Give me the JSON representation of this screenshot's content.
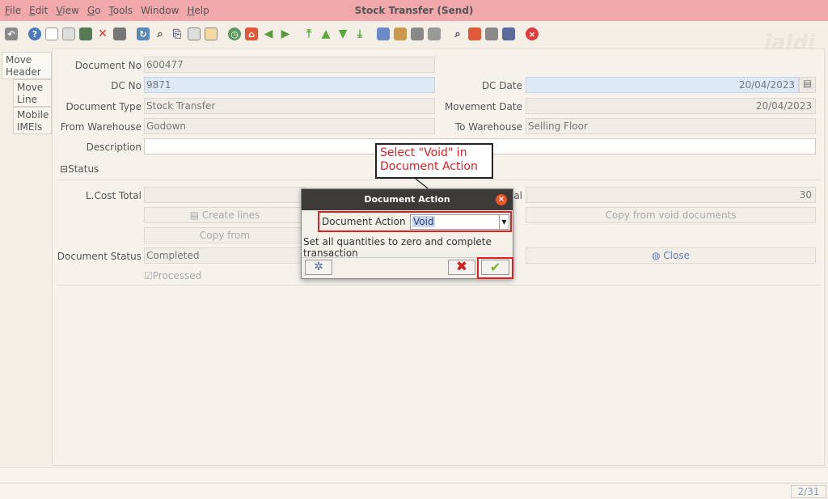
{
  "menu": [
    "File",
    "Edit",
    "View",
    "Go",
    "Tools",
    "Window",
    "Help"
  ],
  "menu_mnemonic": [
    "F",
    "E",
    "V",
    "G",
    "T",
    "",
    "H"
  ],
  "window_title": "Stock Transfer (Send)",
  "watermark": "jaldi",
  "tabs": [
    "Move Header",
    "Move Line",
    "Mobile IMEIs"
  ],
  "form": {
    "document_no_label": "Document No",
    "document_no": "600477",
    "dc_no_label": "DC No",
    "dc_no": "9871",
    "dc_date_label": "DC Date",
    "dc_date": "20/04/2023",
    "document_type_label": "Document Type",
    "document_type": "Stock Transfer",
    "movement_date_label": "Movement Date",
    "movement_date": "20/04/2023",
    "from_warehouse_label": "From Warehouse",
    "from_warehouse": "Godown",
    "to_warehouse_label": "To Warehouse",
    "to_warehouse": "Selling Floor",
    "description_label": "Description",
    "description": ""
  },
  "status": {
    "section_label": "Status",
    "lcost_total_label": "L.Cost Total",
    "right_total_label": "al",
    "right_total": "30",
    "create_lines_label": "Create lines",
    "copy_from_label": "Copy from",
    "copy_from_void_label": "Copy from void documents",
    "document_status_label": "Document Status",
    "document_status": "Completed",
    "close_label": "Close",
    "processed_label": "Processed"
  },
  "callout": {
    "line1": "Select \"Void\" in",
    "line2": "Document Action"
  },
  "dialog": {
    "title": "Document Action",
    "field_label": "Document Action",
    "selected": "Void",
    "description_line1": "Set all quantities to zero and complete",
    "description_line2": "transaction"
  },
  "pager": "2/31",
  "colors": {
    "menubar": "#f0a8aa",
    "highlight": "#e02020",
    "ok_green": "#7bb42a"
  }
}
